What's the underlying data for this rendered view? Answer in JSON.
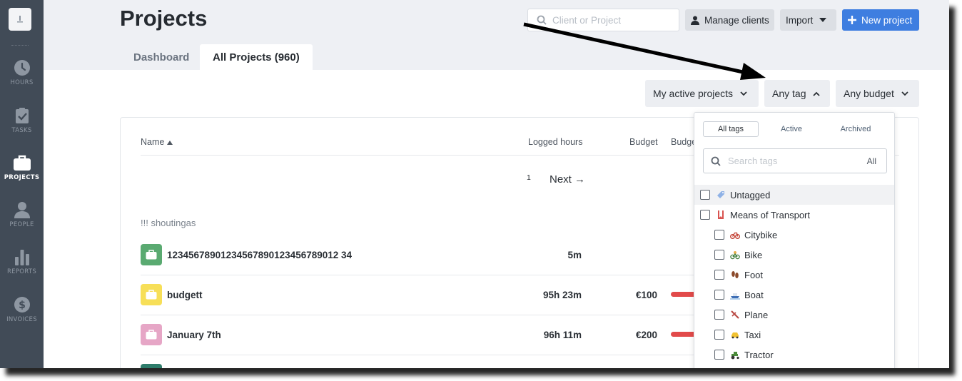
{
  "sidebar": {
    "logo_text": "☰",
    "items": [
      {
        "label": "HOURS",
        "icon": "clock-icon"
      },
      {
        "label": "TASKS",
        "icon": "clipboard-check-icon"
      },
      {
        "label": "PROJECTS",
        "icon": "briefcase-icon",
        "active": true
      },
      {
        "label": "PEOPLE",
        "icon": "person-icon"
      },
      {
        "label": "REPORTS",
        "icon": "bar-chart-icon"
      },
      {
        "label": "INVOICES",
        "icon": "dollar-icon"
      }
    ]
  },
  "header": {
    "title": "Projects",
    "search_placeholder": "Client or Project",
    "manage_clients_label": "Manage clients",
    "import_label": "Import",
    "new_project_label": "New project"
  },
  "tabs": [
    {
      "label": "Dashboard",
      "active": false
    },
    {
      "label": "All Projects (960)",
      "active": true
    }
  ],
  "filters": {
    "projects": "My active projects",
    "tag": "Any tag",
    "budget": "Any budget"
  },
  "table": {
    "columns": {
      "name": "Name",
      "logged_hours": "Logged hours",
      "budget": "Budget",
      "budget_used": "Budge"
    },
    "pager": {
      "page": "1",
      "next": "Next →"
    },
    "group": "!!! shoutingas",
    "rows": [
      {
        "name": "12345678901234567890123456789012 34",
        "hours": "5m",
        "budget": "",
        "color": "#5aaa71"
      },
      {
        "name": "budgett",
        "hours": "95h 23m",
        "budget": "€100",
        "color": "#f7df58"
      },
      {
        "name": "January 7th",
        "hours": "96h 11m",
        "budget": "€200",
        "color": "#e6a6c6"
      }
    ]
  },
  "tag_dropdown": {
    "tabs": [
      "All tags",
      "Active",
      "Archived"
    ],
    "search_placeholder": "Search tags",
    "search_scope": "All",
    "items": [
      {
        "label": "Untagged",
        "icon": "tag-icon",
        "indent": false
      },
      {
        "label": "Means of Transport",
        "icon": "bookmark-icon",
        "indent": false
      },
      {
        "label": "Citybike",
        "icon": "bicycle-icon",
        "indent": true
      },
      {
        "label": "Bike",
        "icon": "mountain-bike-icon",
        "indent": true
      },
      {
        "label": "Foot",
        "icon": "footprints-icon",
        "indent": true
      },
      {
        "label": "Boat",
        "icon": "boat-icon",
        "indent": true
      },
      {
        "label": "Plane",
        "icon": "plane-icon",
        "indent": true
      },
      {
        "label": "Taxi",
        "icon": "taxi-icon",
        "indent": true
      },
      {
        "label": "Tractor",
        "icon": "tractor-icon",
        "indent": true
      }
    ]
  },
  "colors": {
    "sidebar_bg": "#414b57",
    "accent_blue": "#3e7ee0",
    "budget_bar": "#e24a4a"
  }
}
